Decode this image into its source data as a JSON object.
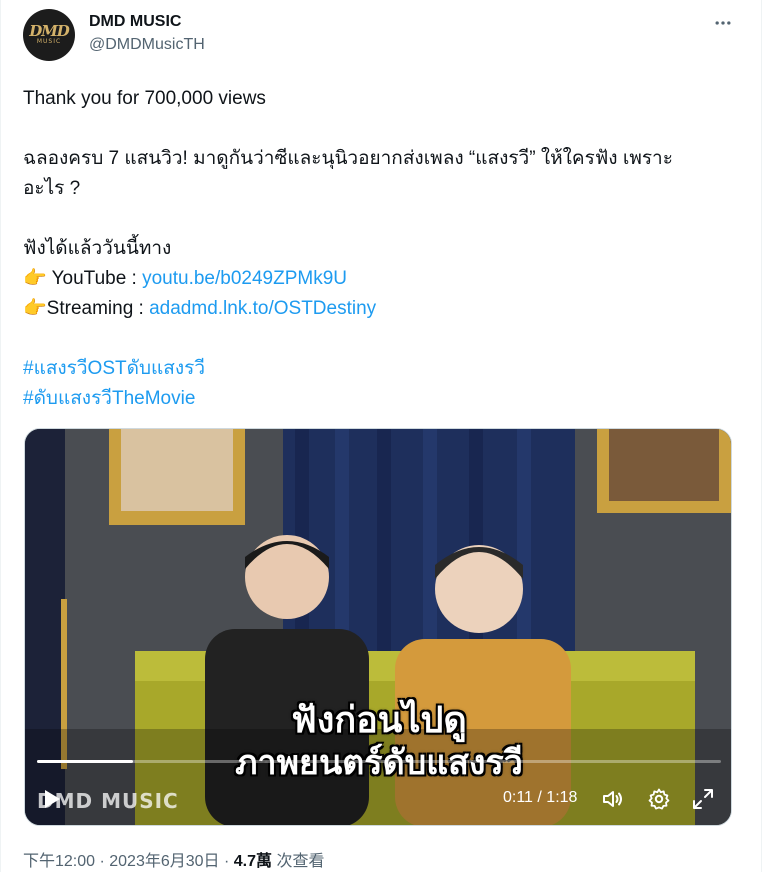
{
  "author": {
    "display_name": "DMD MUSIC",
    "handle": "@DMDMusicTH",
    "avatar_logo_top": "DMD",
    "avatar_logo_bottom": "MUSIC"
  },
  "tweet": {
    "line1": "Thank you for 700,000 views",
    "line2": "ฉลองครบ 7 แสนวิว! มาดูกันว่าซีและนุนิวอยากส่งเพลง “แสงรวี” ให้ใครฟัง เพราะ",
    "line3": "อะไร ?",
    "line4": "ฟังได้แล้ววันนี้ทาง",
    "youtube_emoji": "👉",
    "youtube_label": " YouTube : ",
    "youtube_link": "youtu.be/b0249ZPMk9U",
    "streaming_emoji": "👉",
    "streaming_label": "Streaming : ",
    "streaming_link": "adadmd.lnk.to/OSTDestiny",
    "hashtag1": "#แสงรวีOSTดับแสงรวี",
    "hashtag2": "#ดับแสงรวีTheMovie"
  },
  "video": {
    "caption_line1": "ฟังก่อนไปดู",
    "caption_line2": "ภาพยนตร์ดับแสงรวี",
    "watermark": "DMD MUSIC",
    "time": "0:11 / 1:18",
    "progress": 0.14
  },
  "meta": {
    "timestamp": "下午12:00 · 2023年6月30日 · ",
    "views_count": "4.7萬",
    "views_label": " 次查看"
  },
  "icons": {
    "more": "more-horizontal-icon",
    "play": "play-icon",
    "volume": "volume-icon",
    "settings": "gear-icon",
    "fullscreen": "fullscreen-icon"
  },
  "colors": {
    "link": "#1d9bf0",
    "secondary_text": "#536471",
    "primary_text": "#0f1419"
  }
}
